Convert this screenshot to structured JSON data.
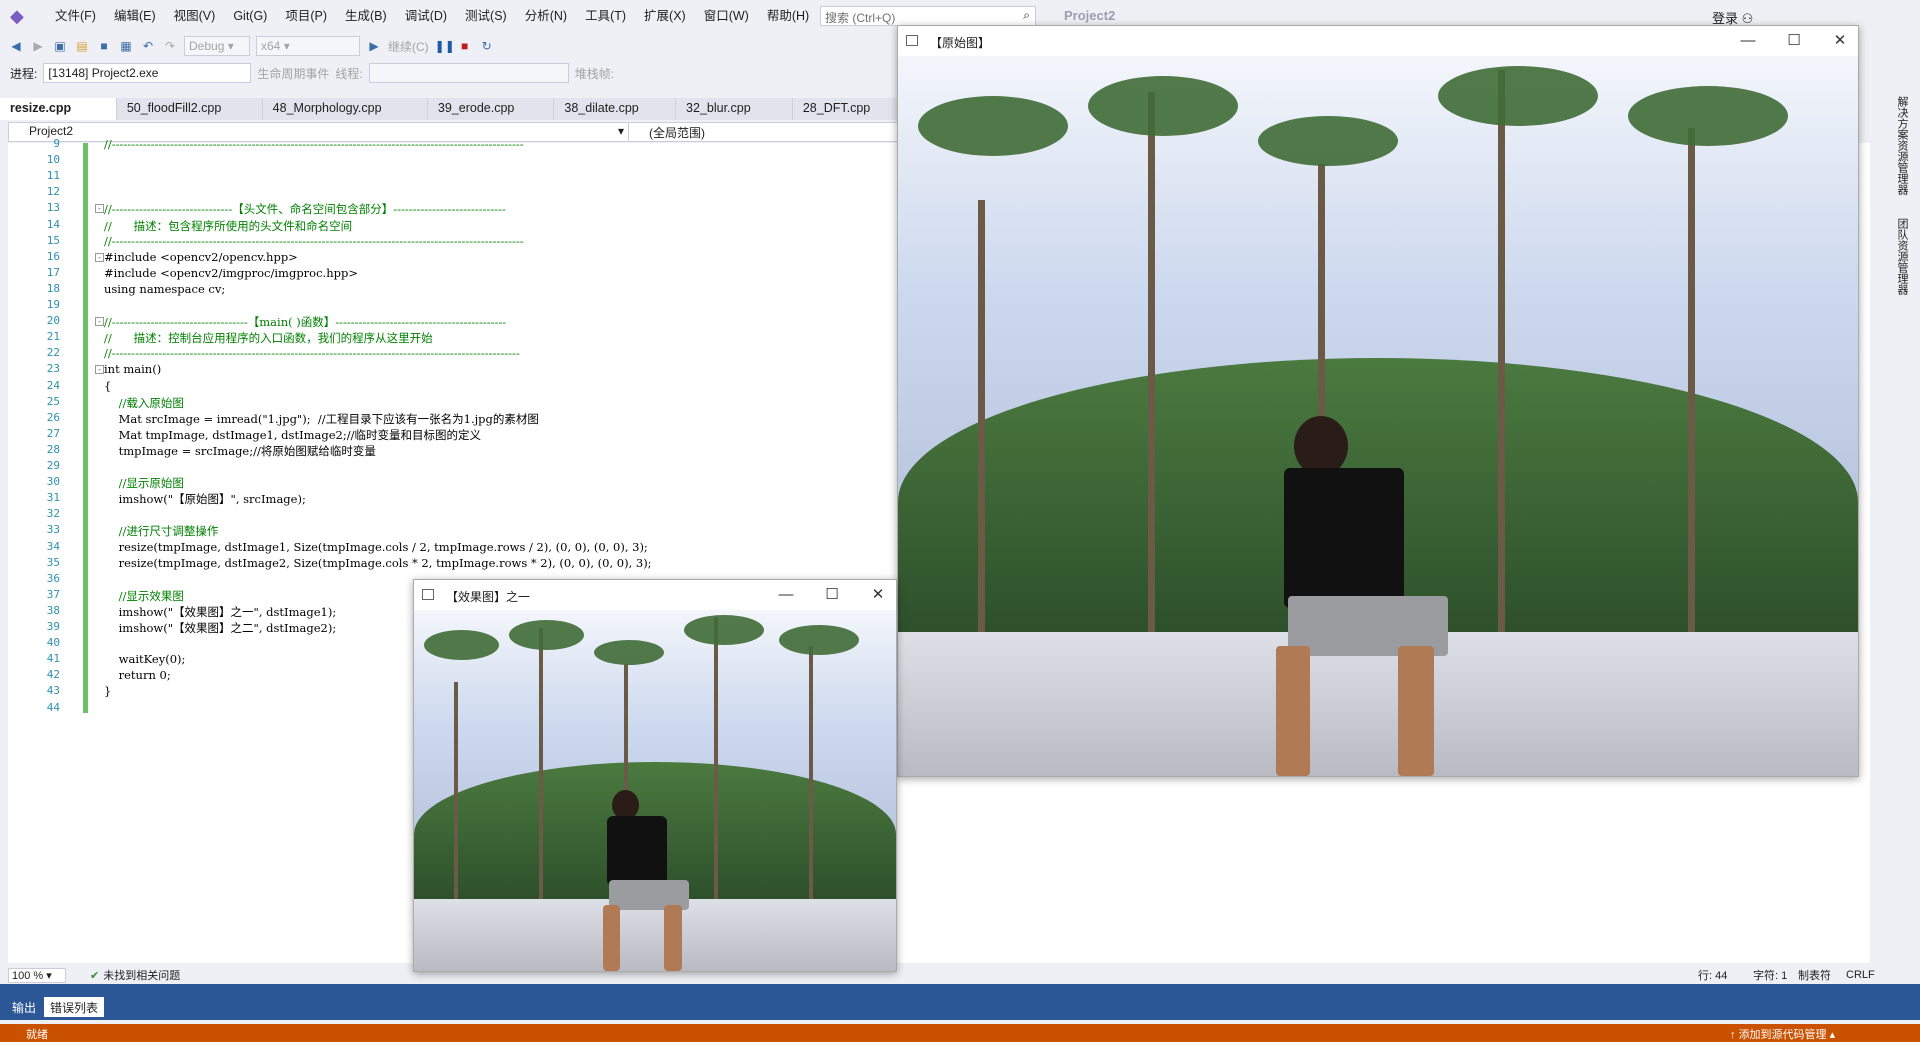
{
  "menubar": {
    "items": [
      "文件(F)",
      "编辑(E)",
      "视图(V)",
      "Git(G)",
      "项目(P)",
      "生成(B)",
      "调试(D)",
      "测试(S)",
      "分析(N)",
      "工具(T)",
      "扩展(X)",
      "窗口(W)",
      "帮助(H)"
    ],
    "search_placeholder": "搜索 (Ctrl+Q)",
    "project": "Project2",
    "login": "登录"
  },
  "toolbar": {
    "config": "Debug",
    "platform": "x64",
    "continue": "继续(C)"
  },
  "toolbar2": {
    "process_label": "进程:",
    "process_value": "[13148] Project2.exe",
    "lifecycle": "生命周期事件",
    "thread_label": "线程:",
    "stack_label": "堆栈帧:"
  },
  "tabs": [
    "resize.cpp",
    "50_floodFill2.cpp",
    "48_Morphology.cpp",
    "39_erode.cpp",
    "38_dilate.cpp",
    "32_blur.cpp",
    "28_DFT.cpp"
  ],
  "nav": {
    "project": "Project2",
    "scope": "(全局范围)"
  },
  "code": {
    "lines": [
      {
        "n": "9",
        "t": "//----------------------------------------------------------------------------------------------------------",
        "c": "c-green",
        "f": ""
      },
      {
        "n": "10",
        "t": "",
        "c": "",
        "f": ""
      },
      {
        "n": "11",
        "t": "",
        "c": "",
        "f": ""
      },
      {
        "n": "12",
        "t": "",
        "c": "",
        "f": ""
      },
      {
        "n": "13",
        "t": "//-------------------------------【头文件、命名空间包含部分】-----------------------------",
        "c": "c-green",
        "f": "⊟"
      },
      {
        "n": "14",
        "t": "//      描述：包含程序所使用的头文件和命名空间",
        "c": "c-green",
        "f": ""
      },
      {
        "n": "15",
        "t": "//----------------------------------------------------------------------------------------------------------",
        "c": "c-green",
        "f": ""
      },
      {
        "n": "16",
        "t": "#include <opencv2/opencv.hpp>",
        "c": "",
        "f": "⊟"
      },
      {
        "n": "17",
        "t": "#include <opencv2/imgproc/imgproc.hpp>",
        "c": "",
        "f": ""
      },
      {
        "n": "18",
        "t": "using namespace cv;",
        "c": "",
        "f": ""
      },
      {
        "n": "19",
        "t": "",
        "c": "",
        "f": ""
      },
      {
        "n": "20",
        "t": "//-----------------------------------【main( )函数】--------------------------------------------",
        "c": "c-green",
        "f": "⊟"
      },
      {
        "n": "21",
        "t": "//      描述：控制台应用程序的入口函数，我们的程序从这里开始",
        "c": "c-green",
        "f": ""
      },
      {
        "n": "22",
        "t": "//---------------------------------------------------------------------------------------------------------",
        "c": "c-green",
        "f": ""
      },
      {
        "n": "23",
        "t": "int main()",
        "c": "",
        "f": "⊟"
      },
      {
        "n": "24",
        "t": "{",
        "c": "",
        "f": ""
      },
      {
        "n": "25",
        "t": "    //载入原始图",
        "c": "c-green",
        "f": ""
      },
      {
        "n": "26",
        "t": "    Mat srcImage = imread(\"1.jpg\");  //工程目录下应该有一张名为1.jpg的素材图",
        "c": "",
        "f": ""
      },
      {
        "n": "27",
        "t": "    Mat tmpImage, dstImage1, dstImage2;//临时变量和目标图的定义",
        "c": "",
        "f": ""
      },
      {
        "n": "28",
        "t": "    tmpImage = srcImage;//将原始图赋给临时变量",
        "c": "",
        "f": ""
      },
      {
        "n": "29",
        "t": "",
        "c": "",
        "f": ""
      },
      {
        "n": "30",
        "t": "    //显示原始图",
        "c": "c-green",
        "f": ""
      },
      {
        "n": "31",
        "t": "    imshow(\"【原始图】\", srcImage);",
        "c": "",
        "f": ""
      },
      {
        "n": "32",
        "t": "",
        "c": "",
        "f": ""
      },
      {
        "n": "33",
        "t": "    //进行尺寸调整操作",
        "c": "c-green",
        "f": ""
      },
      {
        "n": "34",
        "t": "    resize(tmpImage, dstImage1, Size(tmpImage.cols / 2, tmpImage.rows / 2), (0, 0), (0, 0), 3);",
        "c": "",
        "f": ""
      },
      {
        "n": "35",
        "t": "    resize(tmpImage, dstImage2, Size(tmpImage.cols * 2, tmpImage.rows * 2), (0, 0), (0, 0), 3);",
        "c": "",
        "f": ""
      },
      {
        "n": "36",
        "t": "",
        "c": "",
        "f": ""
      },
      {
        "n": "37",
        "t": "    //显示效果图",
        "c": "c-green",
        "f": ""
      },
      {
        "n": "38",
        "t": "    imshow(\"【效果图】之一\", dstImage1);",
        "c": "",
        "f": ""
      },
      {
        "n": "39",
        "t": "    imshow(\"【效果图】之二\", dstImage2);",
        "c": "",
        "f": ""
      },
      {
        "n": "40",
        "t": "",
        "c": "",
        "f": ""
      },
      {
        "n": "41",
        "t": "    waitKey(0);",
        "c": "",
        "f": ""
      },
      {
        "n": "42",
        "t": "    return 0;",
        "c": "",
        "f": ""
      },
      {
        "n": "43",
        "t": "}",
        "c": "",
        "f": ""
      },
      {
        "n": "44",
        "t": "",
        "c": "",
        "f": ""
      }
    ]
  },
  "status": {
    "zoom": "100 %",
    "issues": "未找到相关问题",
    "line": "行: 44",
    "char": "字符: 1",
    "tabs": "制表符",
    "eol": "CRLF"
  },
  "bottom": {
    "output": "输出",
    "errors": "错误列表",
    "ready": "就绪",
    "add_scm": "添加到源代码管理"
  },
  "rail": {
    "a": "解决方案资源管理器",
    "b": "团队资源管理器"
  },
  "win_src": {
    "title": "【原始图】"
  },
  "win_dst": {
    "title": "【效果图】之一"
  }
}
